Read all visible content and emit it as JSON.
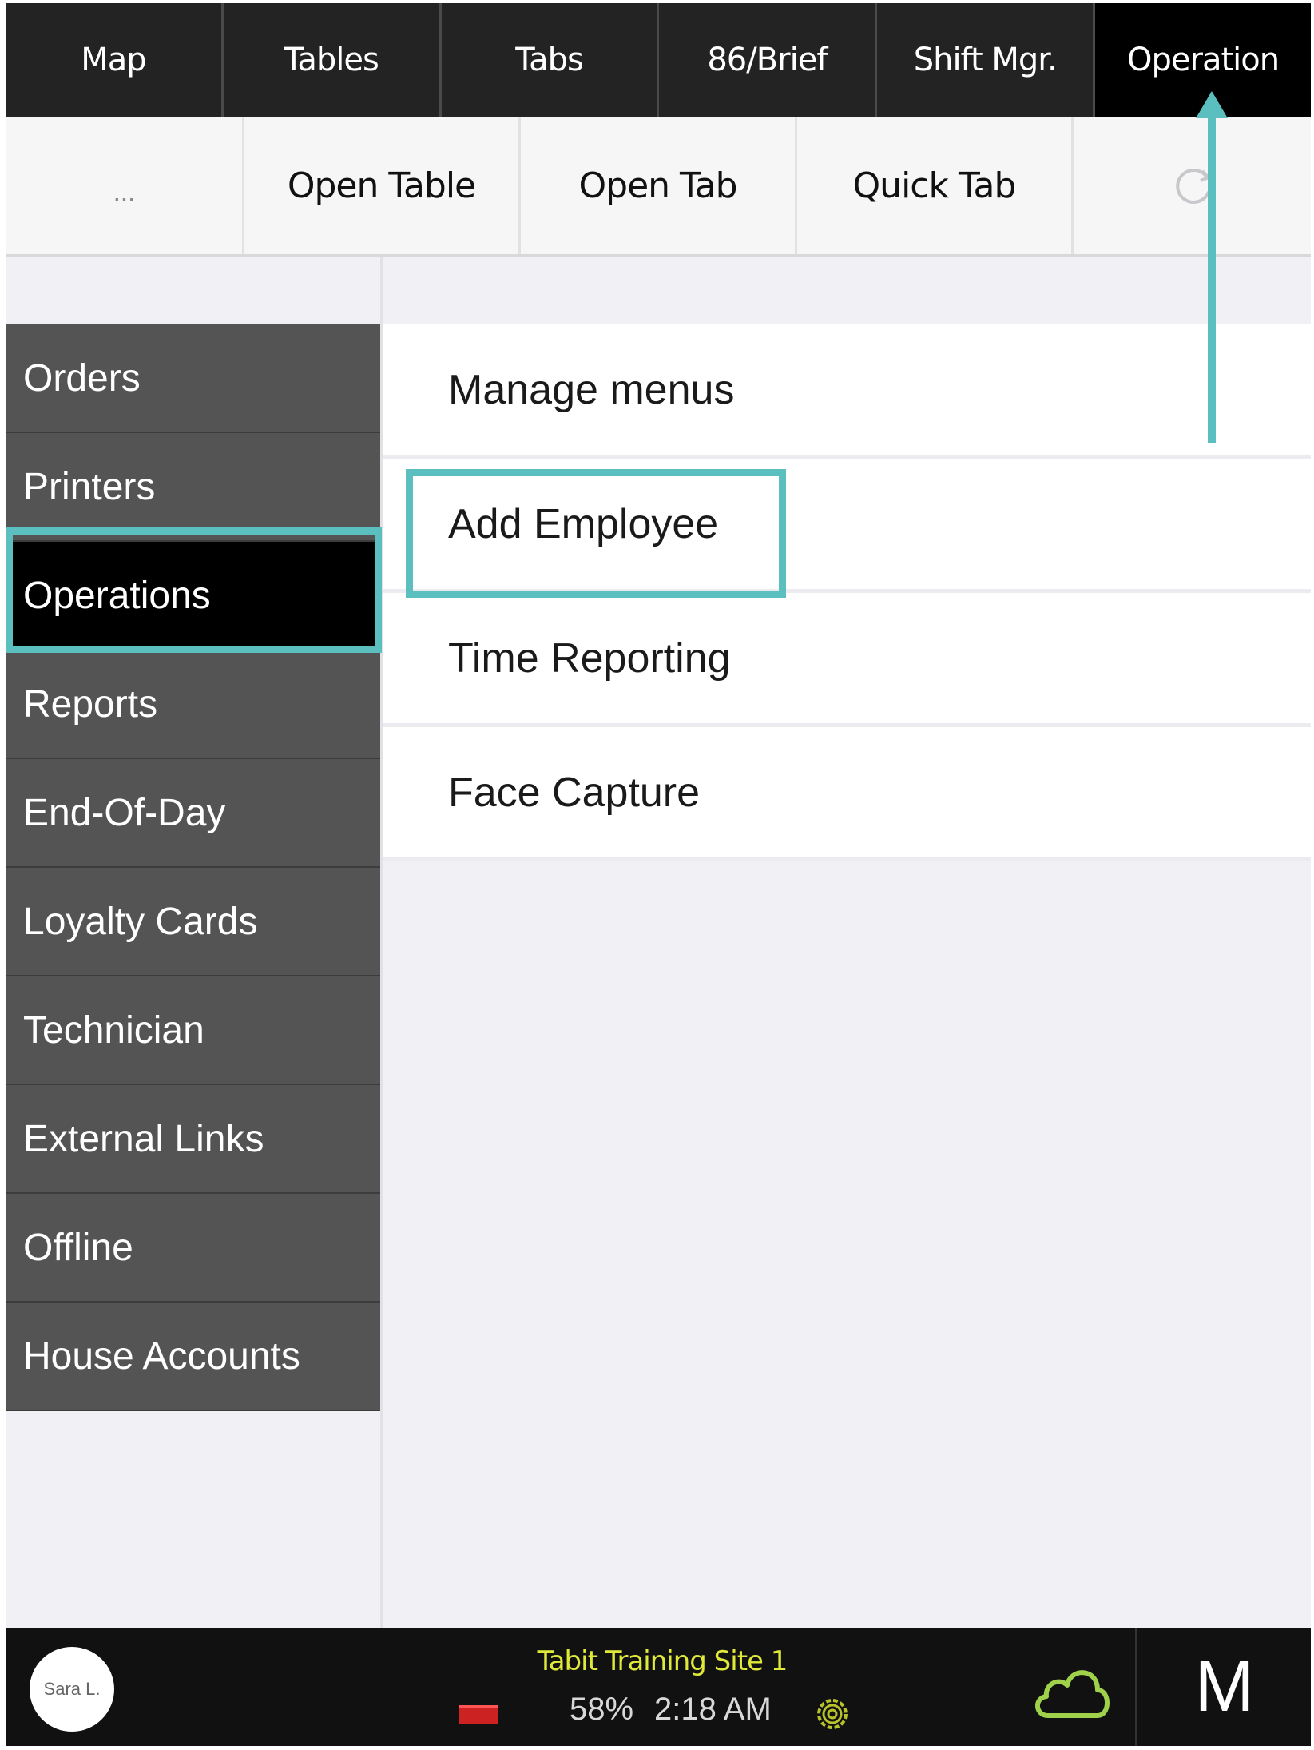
{
  "topnav": {
    "items": [
      {
        "label": "Map"
      },
      {
        "label": "Tables"
      },
      {
        "label": "Tabs"
      },
      {
        "label": "86/Brief"
      },
      {
        "label": "Shift Mgr."
      },
      {
        "label": "Operation"
      }
    ],
    "active": "Operation"
  },
  "toolbar": {
    "more_label": "...",
    "open_table_label": "Open Table",
    "open_tab_label": "Open Tab",
    "quick_tab_label": "Quick Tab",
    "refresh_icon": "refresh-icon"
  },
  "leftmenu": {
    "items": [
      {
        "label": "Orders"
      },
      {
        "label": "Printers"
      },
      {
        "label": "Operations"
      },
      {
        "label": "Reports"
      },
      {
        "label": "End-Of-Day"
      },
      {
        "label": "Loyalty Cards"
      },
      {
        "label": "Technician"
      },
      {
        "label": "External Links"
      },
      {
        "label": "Offline"
      },
      {
        "label": "House Accounts"
      }
    ],
    "active": "Operations"
  },
  "operations": {
    "items": [
      {
        "label": "Manage menus"
      },
      {
        "label": "Add Employee"
      },
      {
        "label": "Time Reporting"
      },
      {
        "label": "Face Capture"
      }
    ]
  },
  "bottombar": {
    "user_name": "Sara L.",
    "site_name": "Tabit Training Site 1",
    "battery": "58%",
    "time": "2:18 AM",
    "right_label": "M",
    "site_name_color": "#dfe93a",
    "cloud_color": "#9fd24a"
  },
  "colors": {
    "annotation": "#5bbfc0",
    "nav_bg": "#232323",
    "menu_bg": "#545454",
    "active_bg": "#000000"
  }
}
